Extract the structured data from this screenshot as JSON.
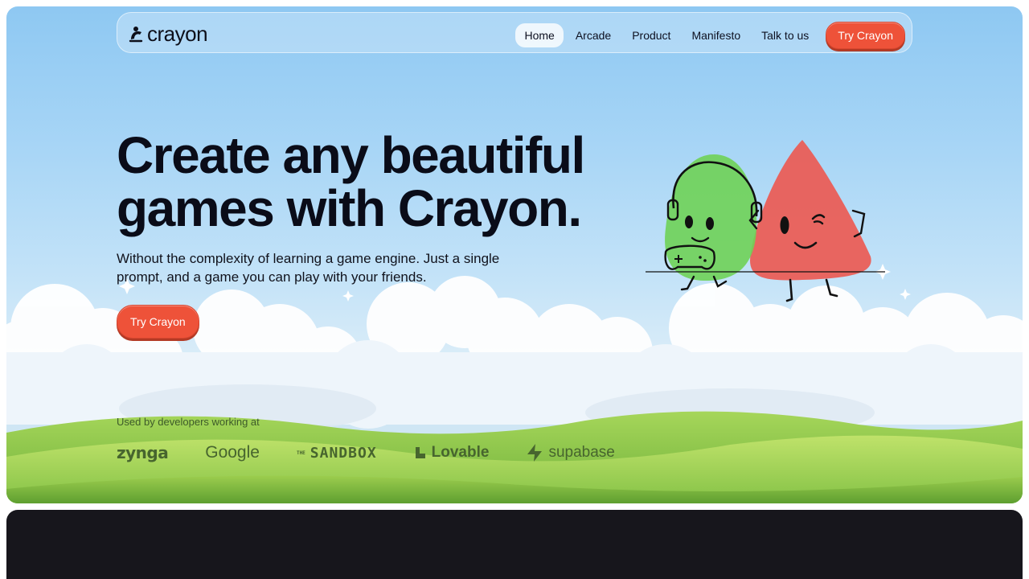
{
  "nav": {
    "logo": "crayon",
    "links": [
      {
        "label": "Home",
        "active": true
      },
      {
        "label": "Arcade"
      },
      {
        "label": "Product"
      },
      {
        "label": "Manifesto"
      },
      {
        "label": "Talk to us"
      }
    ],
    "cta": "Try Crayon"
  },
  "hero": {
    "headline": "Create any beautiful games with Crayon.",
    "subline": "Without the complexity of learning a game engine. Just a single prompt, and a game you can play with your friends.",
    "cta": "Try Crayon"
  },
  "social_proof": {
    "label": "Used by developers working at",
    "brands": [
      "zynga",
      "Google",
      "SANDBOX",
      "Lovable",
      "supabase"
    ],
    "sandbox_prefix": "THE"
  },
  "colors": {
    "accent": "#ee5239",
    "text": "#0a0c18",
    "dark_section": "#17161c",
    "brand_green": "#47652e"
  }
}
